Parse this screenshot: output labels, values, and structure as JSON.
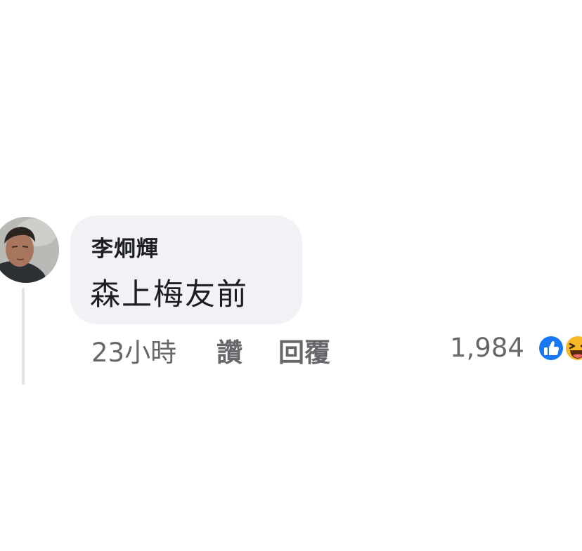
{
  "comment": {
    "author": "李炯輝",
    "text": "森上梅友前",
    "timestamp": "23小時",
    "like_label": "讚",
    "reply_label": "回覆",
    "reaction_count": "1,984",
    "reactions": [
      "like-icon",
      "haha-icon"
    ]
  },
  "colors": {
    "bubble": "#f0f2f5",
    "meta_text": "#65676b",
    "like_blue": "#1877f2",
    "haha_yellow": "#f7b928"
  }
}
